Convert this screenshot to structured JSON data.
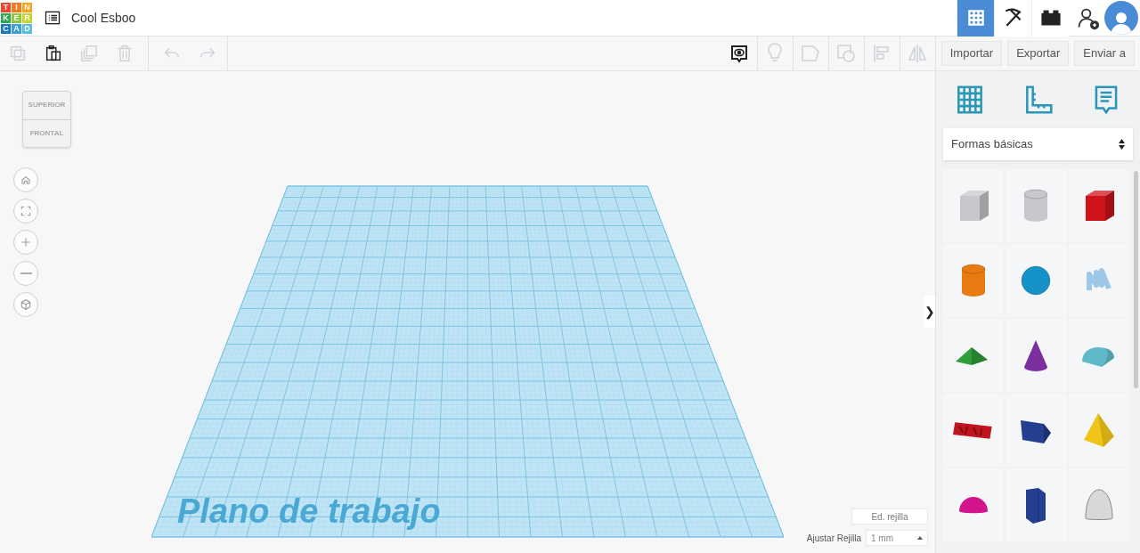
{
  "logo": {
    "rows": [
      [
        "T",
        "I",
        "N"
      ],
      [
        "K",
        "E",
        "R"
      ],
      [
        "C",
        "A",
        "D"
      ]
    ]
  },
  "design_title": "Cool Esboo",
  "view_switch": [
    {
      "kind": "grid",
      "selected": true
    },
    {
      "kind": "pickaxe",
      "selected": false
    },
    {
      "kind": "bricks",
      "selected": false
    }
  ],
  "edit_toolbar": [
    {
      "kind": "copy",
      "disabled": true
    },
    {
      "kind": "paste",
      "disabled": false
    },
    {
      "kind": "duplicate",
      "disabled": true
    },
    {
      "kind": "delete",
      "disabled": true
    },
    {
      "kind": "undo",
      "disabled": true
    },
    {
      "kind": "redo",
      "disabled": true
    }
  ],
  "shape_toolbar": [
    {
      "kind": "notes",
      "disabled": false
    },
    {
      "kind": "light",
      "disabled": true
    },
    {
      "kind": "shape",
      "disabled": true
    },
    {
      "kind": "hole",
      "disabled": true
    },
    {
      "kind": "align",
      "disabled": true
    },
    {
      "kind": "mirror",
      "disabled": true
    }
  ],
  "actions": [
    "Importar",
    "Exportar",
    "Enviar a"
  ],
  "view_cube": {
    "top": "SUPERIOR",
    "front": "FRONTAL"
  },
  "nav_buttons": [
    {
      "kind": "home"
    },
    {
      "kind": "fit"
    },
    {
      "kind": "zoom-in"
    },
    {
      "kind": "zoom-out"
    },
    {
      "kind": "perspective"
    }
  ],
  "workplane": {
    "label": "Plano de trabajo"
  },
  "grid_controls": {
    "edit_button": "Ed. rejilla",
    "snap_label": "Ajustar Rejilla",
    "snap_value": "1 mm"
  },
  "panel_toggle": "❯",
  "panel": {
    "tools": [
      {
        "kind": "workplane"
      },
      {
        "kind": "ruler"
      },
      {
        "kind": "notes"
      }
    ],
    "category": "Formas básicas",
    "shapes": [
      {
        "kind": "box",
        "color": "#c8c8cc"
      },
      {
        "kind": "cylinder",
        "color": "#c8c8cc"
      },
      {
        "kind": "box",
        "color": "#d0121b"
      },
      {
        "kind": "cylinder",
        "color": "#e87a12"
      },
      {
        "kind": "sphere",
        "color": "#1592c8"
      },
      {
        "kind": "scribble",
        "color": "#9cc7e6"
      },
      {
        "kind": "roof",
        "color": "#2f9e3a"
      },
      {
        "kind": "cone",
        "color": "#7b2f9e"
      },
      {
        "kind": "round-roof",
        "color": "#5fb9c9"
      },
      {
        "kind": "text",
        "color": "#c0141e"
      },
      {
        "kind": "polygon",
        "color": "#243f8f"
      },
      {
        "kind": "pyramid",
        "color": "#f0c419"
      },
      {
        "kind": "half-sphere",
        "color": "#d4148c"
      },
      {
        "kind": "prism",
        "color": "#243f8f"
      },
      {
        "kind": "paraboloid",
        "color": "#d8d8d8"
      }
    ]
  }
}
